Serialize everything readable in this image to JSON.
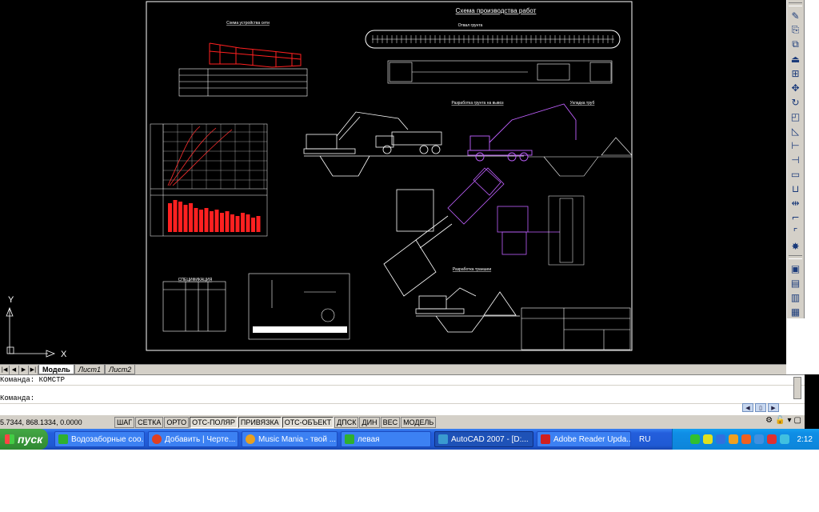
{
  "window": {
    "app": "AutoCAD 2007"
  },
  "drawing": {
    "title_main": "Схема производства работ",
    "subtitle_top": "Отвал грунта",
    "scheme_left_title": "Схема устройства сети",
    "section_excavation": "Разработка грунта на вывоз",
    "section_pipe_laying": "Укладка труб",
    "section_trench": "Разработка траншеи",
    "spec_title": "СПЕЦИФИКАЦИЯ",
    "ucs_y": "Y",
    "ucs_x": "X"
  },
  "tabs": {
    "model": "Модель",
    "sheet1": "Лист1",
    "sheet2": "Лист2"
  },
  "command_line": {
    "line1": "Команда: КОМСТР",
    "line2": "Команда:"
  },
  "status_bar": {
    "coords": "5.7344, 868.1334, 0.0000",
    "buttons": [
      "ШАГ",
      "СЕТКА",
      "ОРТО",
      "ОТС-ПОЛЯР",
      "ПРИВЯЗКА",
      "ОТС-ОБЪЕКТ",
      "ДПСК",
      "ДИН",
      "ВЕС",
      "МОДЕЛЬ"
    ]
  },
  "taskbar": {
    "start": "пуск",
    "tasks": [
      {
        "label": "Водозаборные соо...",
        "icon_color": "#2fb02f"
      },
      {
        "label": "Добавить | Черте...",
        "icon_color": "#e04020"
      },
      {
        "label": "Music Mania - твой ...",
        "icon_color": "#e8a020"
      },
      {
        "label": "левая",
        "icon_color": "#2fb02f"
      },
      {
        "label": "AutoCAD 2007 - [D:...",
        "icon_color": "#3a9ad0"
      },
      {
        "label": "Adobe Reader Upda...",
        "icon_color": "#d02020"
      }
    ],
    "lang": "RU",
    "clock": "2:12"
  }
}
